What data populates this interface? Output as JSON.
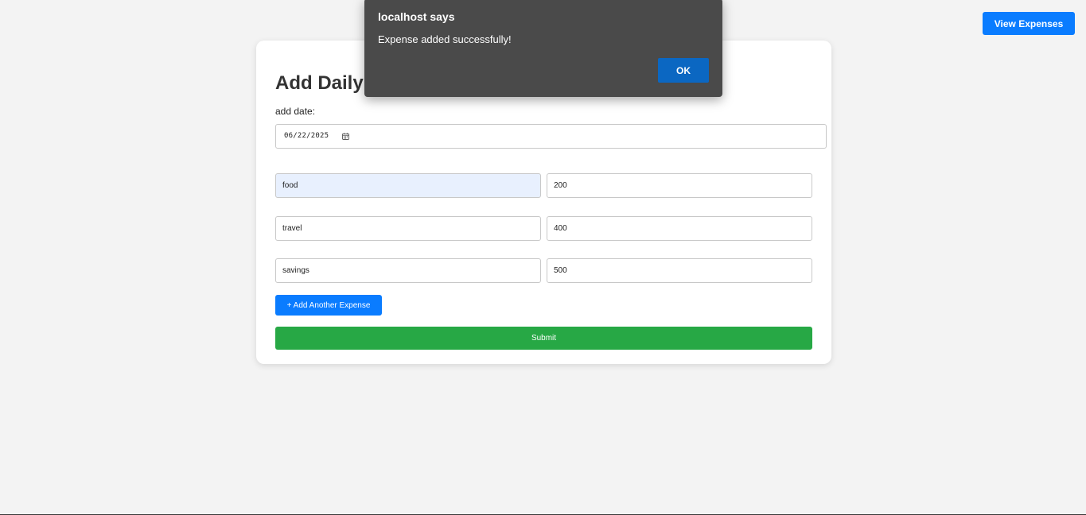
{
  "header": {
    "view_expenses_label": "View Expenses"
  },
  "form": {
    "title": "Add Daily Expenses",
    "date_label": "add date:",
    "date_value": "06/22/2025",
    "expenses": [
      {
        "category": "food",
        "amount": "200",
        "autofilled": true
      },
      {
        "category": "travel",
        "amount": "400",
        "autofilled": false
      },
      {
        "category": "savings",
        "amount": "500",
        "autofilled": false
      }
    ],
    "add_another_label": "+ Add Another Expense",
    "submit_label": "Submit"
  },
  "dialog": {
    "title": "localhost says",
    "message": "Expense added successfully!",
    "ok_label": "OK"
  },
  "colors": {
    "primary": "#0a7cff",
    "success": "#27a845",
    "dialog_bg": "#4a4a4a",
    "dialog_button": "#0b67c2",
    "autofill_bg": "#e8f0fe"
  },
  "icons": {
    "date_picker": "calendar-icon"
  }
}
